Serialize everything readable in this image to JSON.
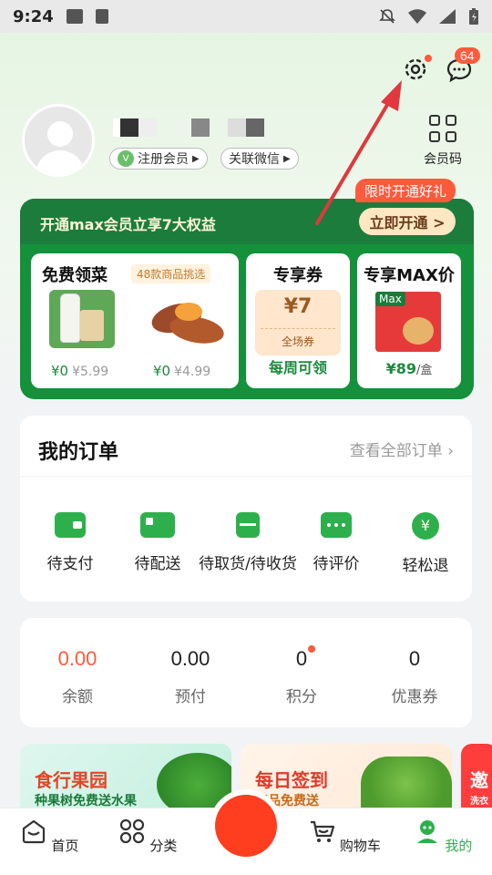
{
  "status_bar": {
    "time": "9:24"
  },
  "header": {
    "settings_icon": "gear-icon",
    "message_icon": "chat-bubble-icon",
    "message_count": "64"
  },
  "profile": {
    "register_member": "注册会员",
    "link_wechat": "关联微信",
    "member_code": "会员码"
  },
  "max": {
    "banner": "开通max会员立享7大权益",
    "open_button": "立即开通 >",
    "limited_tag": "限时开通好礼",
    "free_veg": {
      "title": "免费领菜",
      "tag": "48款商品挑选",
      "item1_price": "¥0",
      "item1_orig": "¥5.99",
      "item2_price": "¥0",
      "item2_orig": "¥4.99"
    },
    "coupon": {
      "title": "专享券",
      "value": "¥7",
      "label": "全场券",
      "weekly": "每周可领"
    },
    "max_price": {
      "title": "专享MAX价",
      "badge": "Max",
      "price": "¥89",
      "unit": "/盒"
    }
  },
  "orders": {
    "title": "我的订单",
    "view_all": "查看全部订单",
    "items": [
      {
        "label": "待支付",
        "icon": "wallet-icon"
      },
      {
        "label": "待配送",
        "icon": "delivery-truck-icon"
      },
      {
        "label": "待取货/待收货",
        "icon": "package-icon"
      },
      {
        "label": "待评价",
        "icon": "comment-icon"
      },
      {
        "label": "轻松退",
        "icon": "refund-icon"
      }
    ]
  },
  "assets": {
    "items": [
      {
        "value": "0.00",
        "label": "余额"
      },
      {
        "value": "0.00",
        "label": "预付"
      },
      {
        "value": "0",
        "label": "积分"
      },
      {
        "value": "0",
        "label": "优惠券"
      }
    ]
  },
  "promos": [
    {
      "title": "食行果园",
      "subtitle": "种果树免费送水果"
    },
    {
      "title": "每日签到",
      "subtitle": "奖品免费送"
    },
    {
      "title": "邀",
      "subtitle": "洗衣"
    }
  ],
  "tabs": [
    {
      "label": "首页",
      "icon": "home-icon"
    },
    {
      "label": "分类",
      "icon": "category-grid-icon"
    },
    {
      "label": "购物车",
      "icon": "cart-icon"
    },
    {
      "label": "我的",
      "icon": "profile-icon"
    }
  ],
  "colors": {
    "accent_green": "#2db04b",
    "dark_green": "#14913a",
    "alert_red": "#ff5a3c",
    "annotation_arrow": "#e0383e"
  }
}
